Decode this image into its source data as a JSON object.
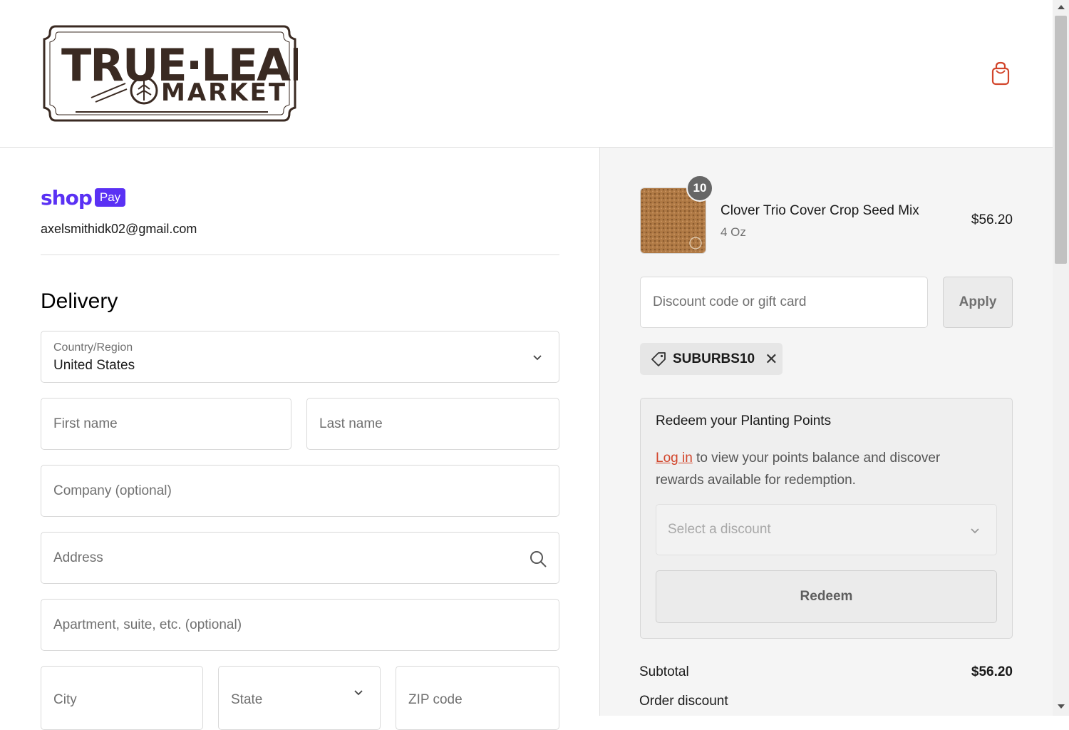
{
  "header": {
    "logo_line1": "TRUE·LEAF",
    "logo_line2": "MARKET",
    "cart_icon": "shopping-bag-icon"
  },
  "express": {
    "shop_text": "shop",
    "pay_text": "Pay",
    "email": "axelsmithidk02@gmail.com"
  },
  "delivery": {
    "heading": "Delivery",
    "country_label": "Country/Region",
    "country_value": "United States",
    "first_name_placeholder": "First name",
    "last_name_placeholder": "Last name",
    "company_placeholder": "Company (optional)",
    "address_placeholder": "Address",
    "apartment_placeholder": "Apartment, suite, etc. (optional)",
    "city_placeholder": "City",
    "state_placeholder": "State",
    "zip_placeholder": "ZIP code"
  },
  "order": {
    "quantity": "10",
    "product_name": "Clover Trio Cover Crop Seed Mix",
    "variant": "4 Oz",
    "price": "$56.20",
    "discount_placeholder": "Discount code or gift card",
    "apply_label": "Apply",
    "applied_code": "SUBURBS10",
    "redeem": {
      "title": "Redeem your Planting Points",
      "login_link": "Log in",
      "text_rest": " to view your points balance and discover rewards available for redemption.",
      "select_placeholder": "Select a discount",
      "button_label": "Redeem"
    },
    "subtotal_label": "Subtotal",
    "subtotal_value": "$56.20",
    "order_discount_label": "Order discount"
  },
  "colors": {
    "shop_pay_purple": "#5a31f4",
    "accent_orange": "#d2452b",
    "sidebar_bg": "#f5f5f5"
  }
}
